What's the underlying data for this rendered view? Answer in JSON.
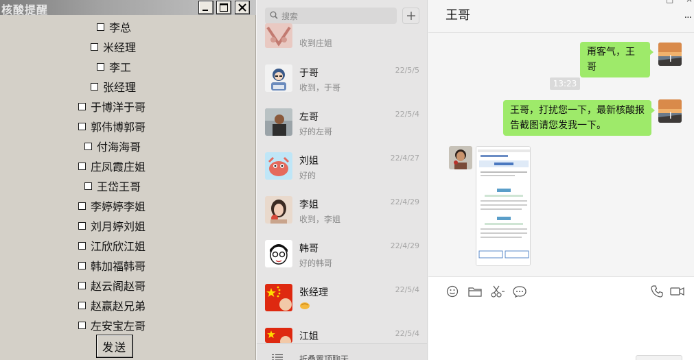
{
  "tool_window": {
    "title": "核酸提醒",
    "contacts": [
      "李总",
      "米经理",
      "李工",
      "张经理",
      "于博洋于哥",
      "郭伟博郭哥",
      "付海海哥",
      "庄凤霞庄姐",
      "王岱王哥",
      "李婷婷李姐",
      "刘月婷刘姐",
      "江欣欣江姐",
      "韩加福韩哥",
      "赵云阁赵哥",
      "赵赢赵兄弟",
      "左安宝左哥"
    ],
    "send_label": "发送"
  },
  "chat_list": {
    "search_placeholder": "搜索",
    "items": [
      {
        "name": "",
        "preview": "收到庄姐",
        "date": ""
      },
      {
        "name": "于哥",
        "preview": "收到，于哥",
        "date": "22/5/5"
      },
      {
        "name": "左哥",
        "preview": "好的左哥",
        "date": "22/5/4"
      },
      {
        "name": "刘姐",
        "preview": "好的",
        "date": "22/4/27"
      },
      {
        "name": "李姐",
        "preview": "收到，李姐",
        "date": "22/4/29"
      },
      {
        "name": "韩哥",
        "preview": "好的韩哥",
        "date": "22/4/29"
      },
      {
        "name": "张经理",
        "preview": "",
        "date": "22/5/4"
      },
      {
        "name": "江姐",
        "preview": "",
        "date": "22/5/4"
      }
    ],
    "folded_label": "折叠置顶聊天"
  },
  "conversation": {
    "title": "王哥",
    "messages": [
      {
        "from": "me",
        "text": "甭客气，王哥"
      },
      {
        "time": "13:23"
      },
      {
        "from": "me",
        "text": "王哥，打扰您一下，最新核酸报告截图请您发我一下。"
      },
      {
        "from": "other",
        "image": "nucleic-acid-report-screenshot"
      }
    ]
  },
  "colors": {
    "accent_green": "#9eea6a",
    "panel_gray": "#d4d0c8",
    "chat_list_bg": "#e6e5e5"
  }
}
